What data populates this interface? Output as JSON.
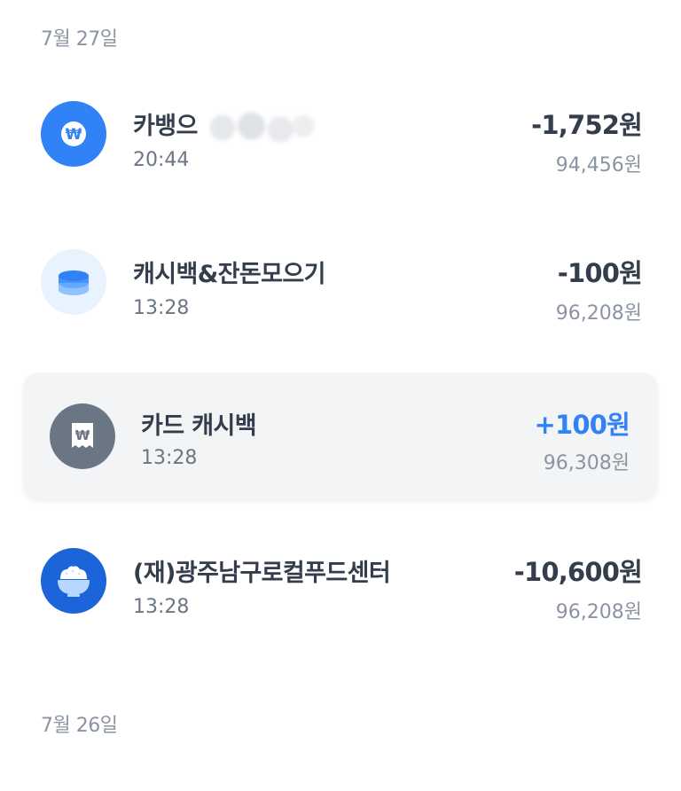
{
  "sections": [
    {
      "date": "7월 27일",
      "transactions": [
        {
          "name": "카뱅으",
          "time": "20:44",
          "amount": "-1,752원",
          "balance": "94,456원",
          "icon": "won-circle-icon",
          "icon_bg": "#3182f6"
        },
        {
          "name": "캐시백&잔돈모으기",
          "time": "13:28",
          "amount": "-100원",
          "balance": "96,208원",
          "icon": "coin-stack-icon",
          "icon_bg": "#e8f3ff"
        },
        {
          "name": "카드 캐시백",
          "time": "13:28",
          "amount": "+100원",
          "balance": "96,308원",
          "icon": "receipt-won-icon",
          "icon_bg": "#6b7684",
          "highlighted": true
        },
        {
          "name": "(재)광주남구로컬푸드센터",
          "time": "13:28",
          "amount": "-10,600원",
          "balance": "96,208원",
          "icon": "rice-bowl-icon",
          "icon_bg": "#1b64da"
        }
      ]
    },
    {
      "date": "7월 26일",
      "transactions": []
    }
  ],
  "colors": {
    "text_primary": "#333d4b",
    "text_secondary": "#6b7684",
    "text_muted": "#8b95a1",
    "positive": "#3182f6",
    "highlight_bg": "#f2f4f6"
  }
}
